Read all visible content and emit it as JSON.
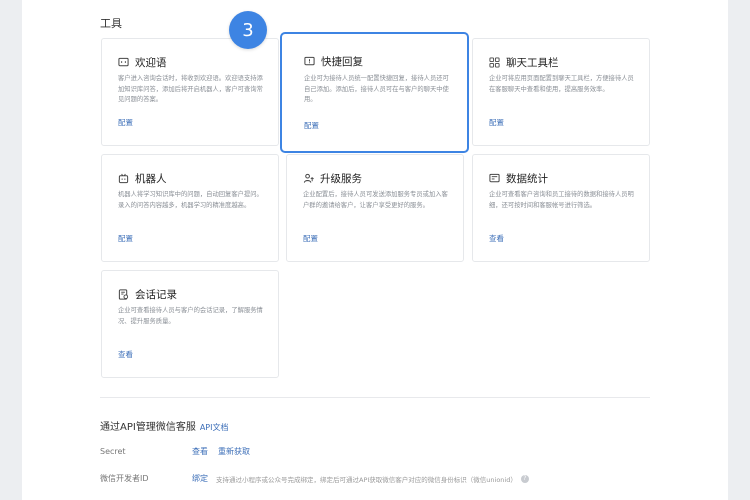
{
  "section": {
    "title": "工具"
  },
  "step": {
    "number": "3"
  },
  "cards": [
    {
      "title": "欢迎语",
      "icon": "chat-bubble-icon",
      "desc": "客户进入咨询会话时，将收到欢迎语。欢迎语支持添加知识库问答，添加后将开启机器人，客户可查询常见问题的答案。",
      "action": "配置"
    },
    {
      "title": "快捷回复",
      "icon": "quick-reply-icon",
      "desc": "企业可为接待人员统一配置快捷回复，接待人员还可自己添加。添加后，接待人员可在与客户的聊天中使用。",
      "action": "配置"
    },
    {
      "title": "聊天工具栏",
      "icon": "grid-icon",
      "desc": "企业可将应用页面配置到聊天工具栏，方便接待人员在客服聊天中查看和使用，提高服务效率。",
      "action": "配置"
    },
    {
      "title": "机器人",
      "icon": "robot-icon",
      "desc": "机器人将学习知识库中的问题，自动回复客户提问。录入的问答内容越多，机器学习的精准度越高。",
      "action": "配置"
    },
    {
      "title": "升级服务",
      "icon": "upgrade-person-icon",
      "desc": "企业配置后，接待人员可发送添加服务专员或加入客户群的邀请给客户，让客户享受更好的服务。",
      "action": "配置"
    },
    {
      "title": "数据统计",
      "icon": "stats-icon",
      "desc": "企业可查看客户咨询和员工接待的数据和接待人员明细，还可按时间和客服帐号进行筛选。",
      "action": "查看"
    },
    {
      "title": "会话记录",
      "icon": "record-icon",
      "desc": "企业可查看接待人员与客户的会话记录，了解服务情况、提升服务质量。",
      "action": "查看"
    }
  ],
  "api": {
    "title": "通过API管理微信客服",
    "doc_link": "API文档",
    "secret": {
      "label": "Secret",
      "view": "查看",
      "refresh": "重新获取"
    },
    "developer": {
      "label": "微信开发者ID",
      "bind": "绑定",
      "hint": "支持通过小程序或公众号完成绑定，绑定后可通过API获取微信客户对应的微信身份标识（微信unionid）"
    }
  },
  "colors": {
    "accent": "#3d84e3",
    "link": "#3d6fb8"
  }
}
